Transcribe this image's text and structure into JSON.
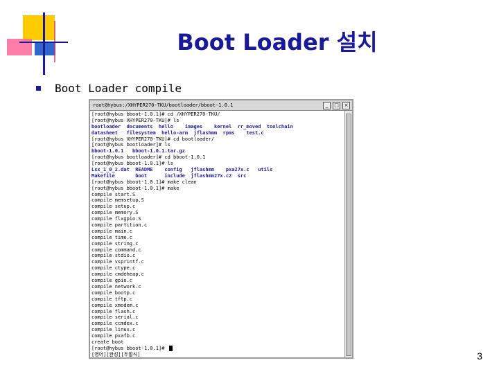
{
  "slide": {
    "title": "Boot Loader 설치",
    "bullet": "Boot Loader compile",
    "page_number": "3"
  },
  "terminal": {
    "title": "root@hybus:/XHYPER270-TKU/bootloader/bboot-1.0.1",
    "buttons": [
      "_",
      "□",
      "×"
    ],
    "lines": [
      "[root@hybus bboot-1.0.1]# cd /XHYPER270-TKU/",
      "[root@hybus XHYPER270-TKU]# ls",
      "bootloader  documents  hello    images    kernel  rr_moved  toolchain",
      "datasheet   filesystem  hello-arm  jflashmm  rpms    test.c",
      "[root@hybus XHYPER270-TKU]# cd bootloader/",
      "[root@hybus bootloader]# ls",
      "bboot-1.0.1   bboot-1.0.1.tar.gz",
      "[root@hybus bootloader]# cd bboot-1.0.1",
      "[root@hybus bboot-1.0.1]# ls",
      "Lsx_1_0_2.dat  README    config   jflashmm    pxa27x.c   utils",
      "Makefile       boot      include  jflashmm27x.c2  src",
      "[root@hybus bboot-1.0.1]# make clean",
      "[root@hybus bboot-1.0.1]# make",
      "compile start.S",
      "compile memsetup.S",
      "compile setup.c",
      "compile memory.S",
      "compile flxgpio.S",
      "compile partition.c",
      "compile main.c",
      "compile time.c",
      "compile string.c",
      "compile command.c",
      "compile stdio.c",
      "compile vsprintf.c",
      "compile ctype.c",
      "compile cmdeheap.c",
      "compile gpio.c",
      "compile network.c",
      "compile bootp.c",
      "compile tftp.c",
      "compile xmodem.c",
      "compile flash.c",
      "compile serial.c",
      "compile ccmdex.c",
      "compile linux.c",
      "compile pxafb.c",
      "create boot",
      "[root@hybus bboot-1.0.1]# ",
      "[영어][완성][두벌식]"
    ]
  }
}
